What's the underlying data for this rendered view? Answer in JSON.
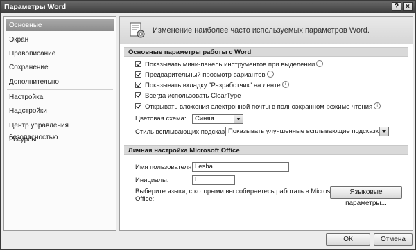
{
  "window": {
    "title": "Параметры Word",
    "help_glyph": "?",
    "close_glyph": "×"
  },
  "sidebar": {
    "items": [
      {
        "label": "Основные",
        "active": true
      },
      {
        "label": "Экран"
      },
      {
        "label": "Правописание"
      },
      {
        "label": "Сохранение"
      },
      {
        "label": "Дополнительно"
      },
      {
        "label": "Настройка"
      },
      {
        "label": "Надстройки"
      },
      {
        "label": "Центр управления безопасностью"
      },
      {
        "label": "Ресурсы"
      }
    ]
  },
  "header": {
    "text": "Изменение наиболее часто используемых параметров Word."
  },
  "section1": {
    "title": "Основные параметры работы с Word",
    "options": [
      {
        "label": "Показывать мини-панель инструментов при выделении",
        "checked": true,
        "info": true
      },
      {
        "label": "Предварительный просмотр вариантов",
        "checked": true,
        "info": true
      },
      {
        "label": "Показывать вкладку \"Разработчик\" на ленте",
        "checked": true,
        "info": true
      },
      {
        "label": "Всегда использовать ClearType",
        "checked": true,
        "info": false
      },
      {
        "label": "Открывать вложения электронной почты в полноэкранном режиме чтения",
        "checked": true,
        "info": true
      }
    ],
    "color_scheme_label": "Цветовая схема:",
    "color_scheme_value": "Синяя",
    "tooltip_style_label": "Стиль всплывающих подсказок:",
    "tooltip_style_value": "Показывать улучшенные всплывающие подсказки"
  },
  "section2": {
    "title": "Личная настройка Microsoft Office",
    "username_label": "Имя пользователя:",
    "username_value": "Lesha",
    "initials_label": "Инициалы:",
    "initials_value": "L",
    "languages_text_1": "Выберите языки, с которыми вы собираетесь работать в Microsoft",
    "languages_text_2": "Office:",
    "languages_button": "Языковые параметры..."
  },
  "footer": {
    "ok": "ОК",
    "cancel": "Отмена"
  },
  "colors": {
    "titlebar": "#4a4a4a",
    "active_nav": "#9a9a9a",
    "section_bar": "#d9d9d9"
  }
}
